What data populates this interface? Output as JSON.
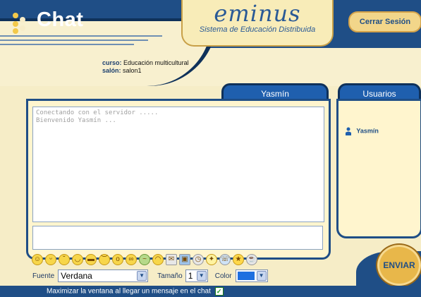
{
  "header": {
    "app_title": "Chat",
    "brand_name": "eminus",
    "brand_subtitle": "Sistema de Educación Distribuida",
    "logout_label": "Cerrar Sesión"
  },
  "session": {
    "course_label": "curso:",
    "course_value": "Educación multicultural",
    "room_label": "salón:",
    "room_value": "salon1"
  },
  "chat": {
    "tab_label": "Yasmín",
    "log_lines": [
      "Conectando con el servidor .....",
      "Bienvenido Yasmín ..."
    ],
    "message_input_value": ""
  },
  "users": {
    "tab_label": "Usuarios",
    "items": [
      {
        "name": "Yasmín"
      }
    ]
  },
  "emoticons": [
    "smile",
    "grin",
    "wink",
    "laugh",
    "cool",
    "sad",
    "surprised",
    "nerd",
    "sick",
    "blush",
    "mail",
    "gift",
    "clock",
    "idea",
    "phone",
    "star",
    "coffee"
  ],
  "controls": {
    "font_label": "Fuente",
    "font_value": "Verdana",
    "size_label": "Tamaño",
    "size_value": "1",
    "color_label": "Color",
    "color_value": "#1e6fe0"
  },
  "send_label": "ENVIAR",
  "footer": {
    "maximize_text": "Maximizar la ventana al llegar un mensaje en el chat",
    "maximize_checked": true
  },
  "colors": {
    "brand_blue": "#1f4e86",
    "cream": "#f6edc7",
    "gold": "#e8b74a"
  }
}
